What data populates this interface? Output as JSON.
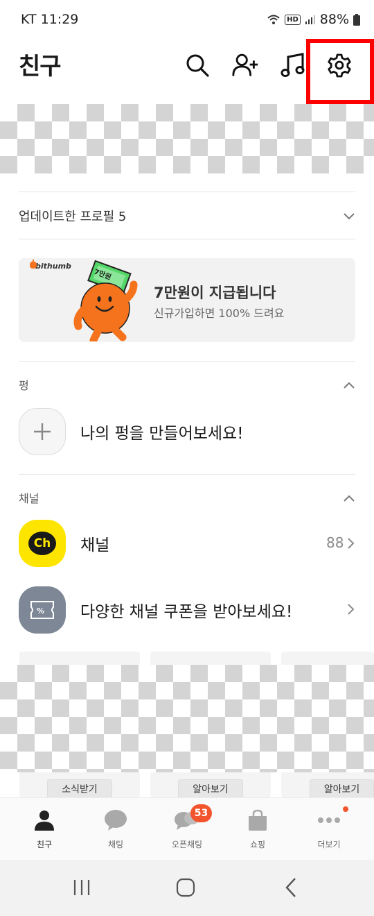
{
  "status_bar": {
    "carrier_time": "KT 11:29",
    "hd": "HD",
    "battery": "88%"
  },
  "header": {
    "title": "친구"
  },
  "update_profile": {
    "label": "업데이트한 프로필 5"
  },
  "banner": {
    "brand": "bithumb",
    "sticker": "7만원",
    "title": "7만원이 지급됩니다",
    "subtitle": "신규가입하면 100% 드려요"
  },
  "pung": {
    "section_label": "펑",
    "create_text": "나의 펑을 만들어보세요!"
  },
  "channel": {
    "section_label": "채널",
    "channel_icon_text": "Ch",
    "channel_item": "채널",
    "channel_count": "88",
    "coupon_item": "다양한 채널 쿠폰을 받아보세요!"
  },
  "cards": [
    {
      "button": "소식받기"
    },
    {
      "button": "알아보기"
    },
    {
      "button": "알아보기"
    }
  ],
  "tabs": [
    {
      "label": "친구",
      "icon": "person-icon"
    },
    {
      "label": "채팅",
      "icon": "chat-bubble-icon"
    },
    {
      "label": "오픈채팅",
      "icon": "open-chat-icon",
      "badge": "53"
    },
    {
      "label": "쇼핑",
      "icon": "shopping-bag-icon"
    },
    {
      "label": "더보기",
      "icon": "more-dots-icon"
    }
  ],
  "colors": {
    "kakao_yellow": "#FEE500",
    "badge_red": "#F2542D",
    "highlight": "#FF0000",
    "coupon_icon": "#7D8796"
  }
}
